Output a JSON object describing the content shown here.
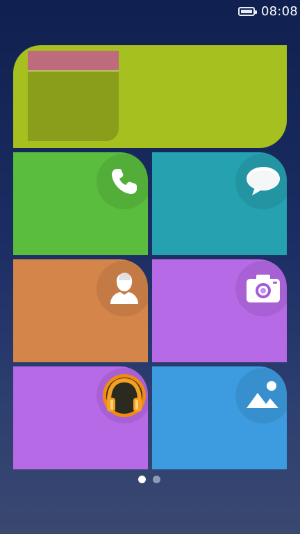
{
  "status_bar": {
    "time": "08:08",
    "battery_icon": "battery-full-icon"
  },
  "home_screen": {
    "widget": {
      "name": "widget-tile",
      "color": "#a6c11f"
    },
    "apps": [
      {
        "name": "phone",
        "icon": "phone-icon",
        "color": "#5abd3d"
      },
      {
        "name": "messages",
        "icon": "message-bubble-icon",
        "color": "#25a1b0"
      },
      {
        "name": "contacts",
        "icon": "contact-person-icon",
        "color": "#d4854a"
      },
      {
        "name": "camera",
        "icon": "camera-icon",
        "color": "#b76ae6"
      },
      {
        "name": "music",
        "icon": "headphones-icon",
        "color": "#b76ae6"
      },
      {
        "name": "gallery",
        "icon": "gallery-mountain-icon",
        "color": "#3d9ce0"
      }
    ],
    "pagination": {
      "current_page": 1,
      "total_pages": 2
    }
  }
}
